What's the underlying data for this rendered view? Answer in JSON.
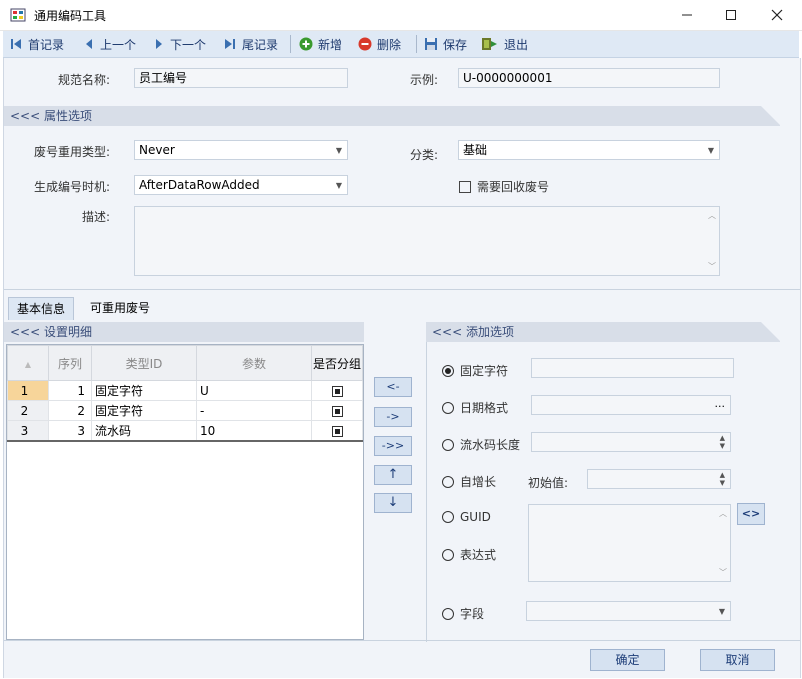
{
  "window": {
    "title": "通用编码工具"
  },
  "toolbar": {
    "first": "首记录",
    "prev": "上一个",
    "next": "下一个",
    "last": "尾记录",
    "add": "新增",
    "delete": "删除",
    "save": "保存",
    "exit": "退出"
  },
  "form": {
    "spec_name_label": "规范名称:",
    "spec_name_value": "员工编号",
    "example_label": "示例:",
    "example_value": "U-0000000001",
    "props_band": "<<< 属性选项",
    "reuse_type_label": "废号重用类型:",
    "reuse_type_value": "Never",
    "category_label": "分类:",
    "category_value": "基础",
    "gen_time_label": "生成编号时机:",
    "gen_time_value": "AfterDataRowAdded",
    "recycle_label": "需要回收废号",
    "desc_label": "描述:"
  },
  "tabs": {
    "basic": "基本信息",
    "reusable": "可重用废号"
  },
  "detail": {
    "band": "<<< 设置明细",
    "columns": {
      "seq": "序列",
      "type": "类型ID",
      "param": "参数",
      "group": "是否分组"
    },
    "rows": [
      {
        "row": "1",
        "seq": "1",
        "type": "固定字符",
        "param": "U",
        "group": true
      },
      {
        "row": "2",
        "seq": "2",
        "type": "固定字符",
        "param": "-",
        "group": true
      },
      {
        "row": "3",
        "seq": "3",
        "type": "流水码",
        "param": "10",
        "group": true
      }
    ]
  },
  "arrows": {
    "left": "<-",
    "right": "->",
    "all_right": "->>",
    "up": "↑",
    "down": "↓"
  },
  "add_options": {
    "band": "<<< 添加选项",
    "fixed_char": "固定字符",
    "date_format": "日期格式",
    "serial_length": "流水码长度",
    "auto_inc": "自增长",
    "initial_label": "初始值:",
    "guid": "GUID",
    "expression": "表达式",
    "field": "字段",
    "date_ellipsis": "...",
    "expr_btn": "<>"
  },
  "footer": {
    "ok": "确定",
    "cancel": "取消"
  },
  "colors": {
    "toolbar_bg": "#dfe9f5",
    "band_bg": "#d8dee8",
    "frame_bg": "#f1f4f9",
    "button_bg": "#d6e2f1"
  }
}
